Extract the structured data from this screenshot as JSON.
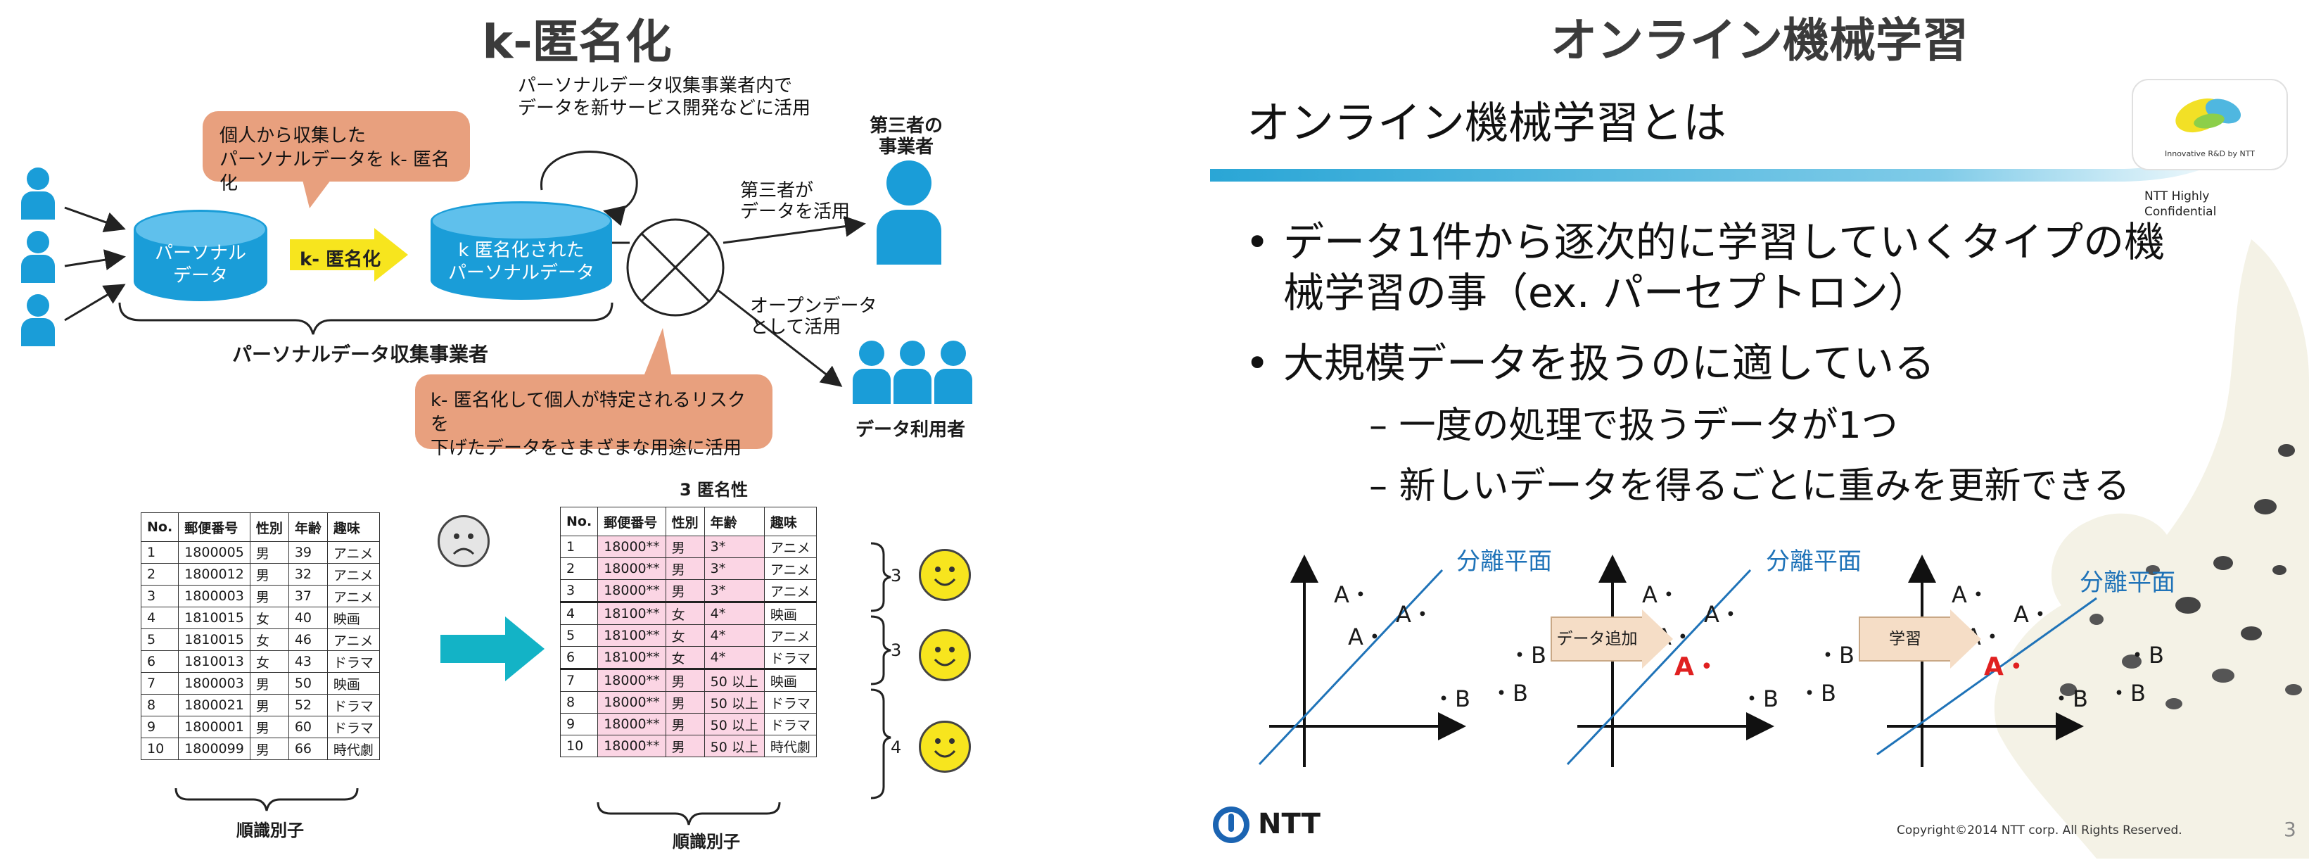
{
  "left": {
    "title": "k-匿名化",
    "callout_top": "個人から収集した\nパーソナルデータを k- 匿名化",
    "note_top": "パーソナルデータ収集事業者内で\nデータを新サービス開発などに活用",
    "db1": "パーソナル\nデータ",
    "arrow_label": "k- 匿名化",
    "db2": "k 匿名化された\nパーソナルデータ",
    "collector": "パーソナルデータ収集事業者",
    "third_party_title": "第三者の\n事業者",
    "third_party_use": "第三者が\nデータを活用",
    "open_data_use": "オープンデータ\nとして活用",
    "data_users": "データ利用者",
    "callout_bottom": "k- 匿名化して個人が特定されるリスクを\n下げたデータをさまざまな用途に活用",
    "table_left": {
      "headers": [
        "No.",
        "郵便番号",
        "性別",
        "年齢",
        "趣味"
      ],
      "rows": [
        [
          "1",
          "1800005",
          "男",
          "39",
          "アニメ"
        ],
        [
          "2",
          "1800012",
          "男",
          "32",
          "アニメ"
        ],
        [
          "3",
          "1800003",
          "男",
          "37",
          "アニメ"
        ],
        [
          "4",
          "1810015",
          "女",
          "40",
          "映画"
        ],
        [
          "5",
          "1810015",
          "女",
          "46",
          "アニメ"
        ],
        [
          "6",
          "1810013",
          "女",
          "43",
          "ドラマ"
        ],
        [
          "7",
          "1800003",
          "男",
          "50",
          "映画"
        ],
        [
          "8",
          "1800021",
          "男",
          "52",
          "ドラマ"
        ],
        [
          "9",
          "1800001",
          "男",
          "60",
          "ドラマ"
        ],
        [
          "10",
          "1800099",
          "男",
          "66",
          "時代劇"
        ]
      ],
      "caption": "順識別子"
    },
    "table_right": {
      "title": "3 匿名性",
      "headers": [
        "No.",
        "郵便番号",
        "性別",
        "年齢",
        "趣味"
      ],
      "rows": [
        [
          "1",
          "18000**",
          "男",
          "3*",
          "アニメ"
        ],
        [
          "2",
          "18000**",
          "男",
          "3*",
          "アニメ"
        ],
        [
          "3",
          "18000**",
          "男",
          "3*",
          "アニメ"
        ],
        [
          "4",
          "18100**",
          "女",
          "4*",
          "映画"
        ],
        [
          "5",
          "18100**",
          "女",
          "4*",
          "アニメ"
        ],
        [
          "6",
          "18100**",
          "女",
          "4*",
          "ドラマ"
        ],
        [
          "7",
          "18000**",
          "男",
          "50 以上",
          "映画"
        ],
        [
          "8",
          "18000**",
          "男",
          "50 以上",
          "ドラマ"
        ],
        [
          "9",
          "18000**",
          "男",
          "50 以上",
          "ドラマ"
        ],
        [
          "10",
          "18000**",
          "男",
          "50 以上",
          "時代劇"
        ]
      ],
      "caption": "順識別子",
      "group_counts": [
        "3",
        "3",
        "4"
      ]
    }
  },
  "right": {
    "header_title": "オンライン機械学習",
    "slide_title": "オンライン機械学習とは",
    "logo_caption": "Innovative R&D by NTT",
    "confidential": "NTT Highly\nConfidential",
    "bullet_1": "データ1件から逐次的に学習していくタイプの機械学習の事（ex. パーセプトロン）",
    "bullet_2": "大規模データを扱うのに適している",
    "sub_1": "– 一度の処理で扱うデータが1つ",
    "sub_2": "– 新しいデータを得るごとに重みを更新できる",
    "plane_label": "分離平面",
    "point_a": "A・",
    "point_b": "・B",
    "step_1": "データ追加",
    "step_2": "学習",
    "ntt_logo": "NTT",
    "copyright": "Copyright©2014  NTT corp. All Rights Reserved.",
    "page_number": "3"
  },
  "colors": {
    "blue": "#1a9dd8",
    "orange": "#e8a07e",
    "yellow": "#f7e51e",
    "teal": "#13b3c6",
    "pink": "#fbd5e4",
    "red": "#e02020",
    "plane": "#1f73b8"
  }
}
